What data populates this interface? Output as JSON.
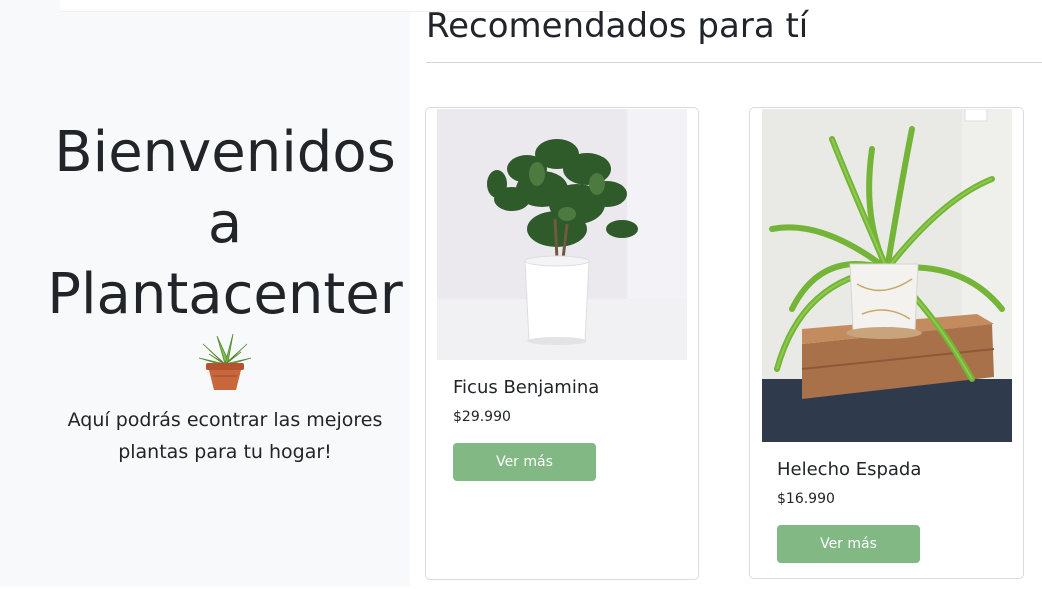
{
  "hero": {
    "title_line1": "Bienvenidos",
    "title_line2": "a",
    "title_line3": "Plantacenter",
    "icon": "potted-plant-icon",
    "subtitle_line1": "Aquí podrás econtrar las mejores",
    "subtitle_line2": "plantas para tu hogar!"
  },
  "recommended": {
    "title": "Recomendados para tí",
    "products": [
      {
        "name": "Ficus Benjamina",
        "price": "$29.990",
        "button_label": "Ver más"
      },
      {
        "name": "Helecho Espada",
        "price": "$16.990",
        "button_label": "Ver más"
      }
    ]
  },
  "colors": {
    "button": "#82b883",
    "hero_background": "#f8f9fa",
    "text": "#212529"
  }
}
